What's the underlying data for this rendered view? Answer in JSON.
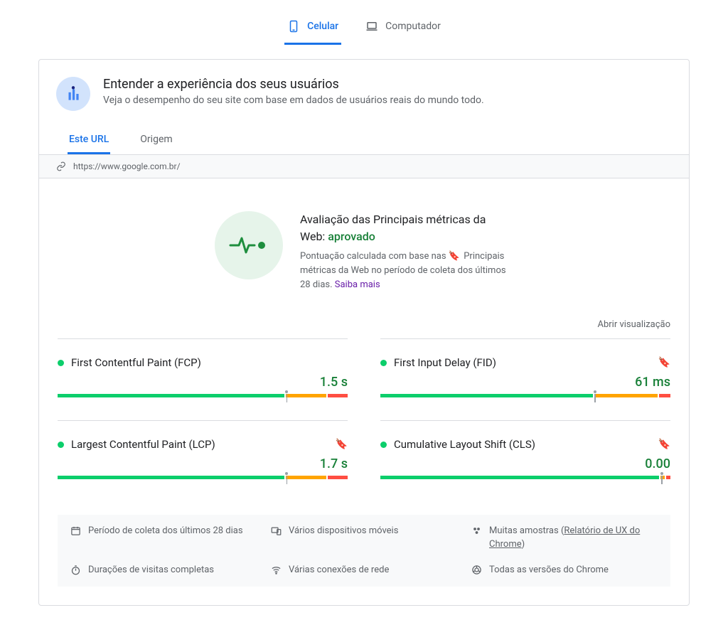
{
  "device_tabs": {
    "mobile": "Celular",
    "desktop": "Computador"
  },
  "header": {
    "title": "Entender a experiência dos seus usuários",
    "subtitle": "Veja o desempenho do seu site com base em dados de usuários reais do mundo todo."
  },
  "scope_tabs": {
    "url": "Este URL",
    "origin": "Origem"
  },
  "url": "https://www.google.com.br/",
  "assessment": {
    "title_prefix": "Avaliação das Principais métricas da Web: ",
    "status": "aprovado",
    "desc_1": "Pontuação calculada com base nas ",
    "desc_link_inline": "Principais métricas da Web",
    "desc_2": " no período de coleta dos últimos 28 dias. ",
    "learn_more": "Saiba mais"
  },
  "open_visualization": "Abrir visualização",
  "metrics": [
    {
      "name": "First Contentful Paint (FCP)",
      "value": "1.5 s",
      "core": false,
      "bar": {
        "g": 79,
        "o": 14,
        "r": 7,
        "marker": 79
      }
    },
    {
      "name": "First Input Delay (FID)",
      "value": "61 ms",
      "core": true,
      "bar": {
        "g": 74,
        "o": 22,
        "r": 4,
        "marker": 74
      }
    },
    {
      "name": "Largest Contentful Paint (LCP)",
      "value": "1.7 s",
      "core": true,
      "bar": {
        "g": 79,
        "o": 14,
        "r": 7,
        "marker": 79
      }
    },
    {
      "name": "Cumulative Layout Shift (CLS)",
      "value": "0.00",
      "core": true,
      "bar": {
        "g": 97,
        "o": 1.5,
        "r": 1.5,
        "marker": 97
      }
    }
  ],
  "footer": {
    "period": "Período de coleta dos últimos 28 dias",
    "devices": "Vários dispositivos móveis",
    "samples_prefix": "Muitas amostras (",
    "samples_link": "Relatório de UX do Chrome",
    "samples_suffix": ")",
    "durations": "Durações de visitas completas",
    "networks": "Várias conexões de rede",
    "versions": "Todas as versões do Chrome"
  }
}
